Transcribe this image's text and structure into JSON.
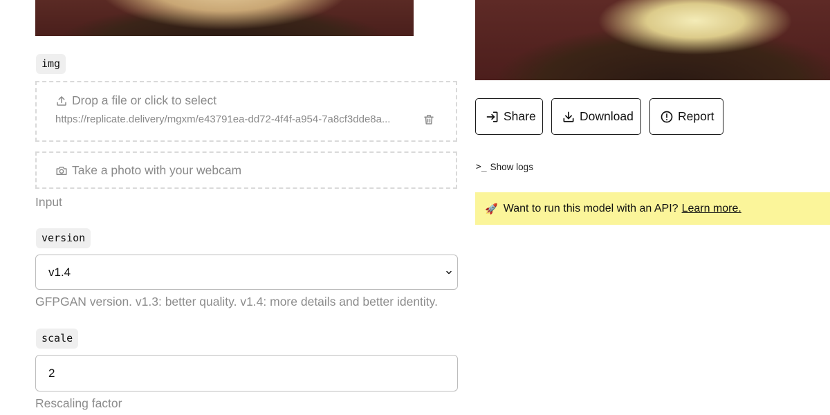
{
  "inputs": {
    "img": {
      "tag": "img",
      "drop_text": "Drop a file or click to select",
      "url": "https://replicate.delivery/mgxm/e43791ea-dd72-4f4f-a954-7a8cf3dde8a...",
      "webcam_text": "Take a photo with your webcam",
      "helper": "Input"
    },
    "version": {
      "tag": "version",
      "value": "v1.4",
      "helper": "GFPGAN version. v1.3: better quality. v1.4: more details and better identity."
    },
    "scale": {
      "tag": "scale",
      "value": "2",
      "helper": "Rescaling factor"
    }
  },
  "output": {
    "buttons": {
      "share": "Share",
      "download": "Download",
      "report": "Report"
    },
    "show_logs": "Show logs",
    "api_banner": {
      "emoji": "🚀",
      "text": "Want to run this model with an API?",
      "link": "Learn more."
    }
  },
  "colors": {
    "banner": "#fbf59a",
    "border": "#1a1a1a",
    "helper_text": "#8c8c8c"
  },
  "icons": [
    "upload-icon",
    "trash-icon",
    "camera-icon",
    "chevron-down-icon",
    "share-icon",
    "download-icon",
    "report-icon",
    "terminal-icon",
    "rocket-icon"
  ]
}
